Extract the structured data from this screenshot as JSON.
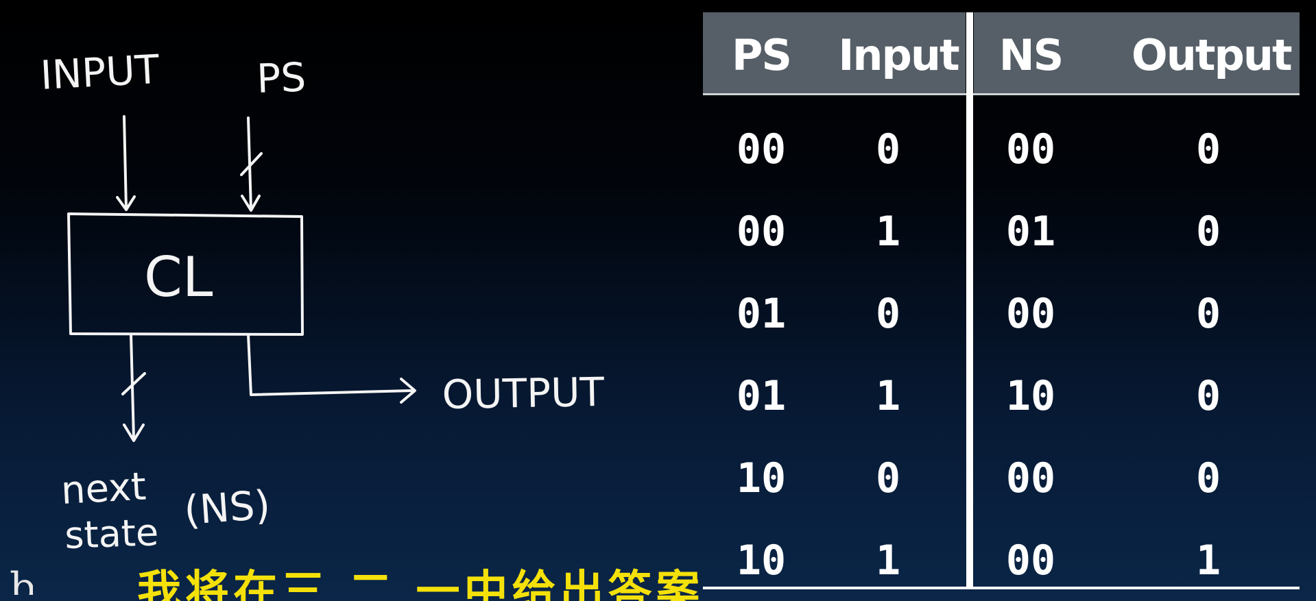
{
  "diagram": {
    "input_label": "INPUT",
    "ps_label": "PS",
    "block_label": "CL",
    "output_label": "OUTPUT",
    "next_label": "next",
    "state_label": "state",
    "ns_label": "(NS)"
  },
  "table": {
    "headers": {
      "ps": "PS",
      "input": "Input",
      "ns": "NS",
      "output": "Output"
    },
    "rows": [
      {
        "ps": "00",
        "input": "0",
        "ns": "00",
        "output": "0"
      },
      {
        "ps": "00",
        "input": "1",
        "ns": "01",
        "output": "0"
      },
      {
        "ps": "01",
        "input": "0",
        "ns": "00",
        "output": "0"
      },
      {
        "ps": "01",
        "input": "1",
        "ns": "10",
        "output": "0"
      },
      {
        "ps": "10",
        "input": "0",
        "ns": "00",
        "output": "0"
      },
      {
        "ps": "10",
        "input": "1",
        "ns": "00",
        "output": "1"
      }
    ]
  },
  "subtitle": {
    "text": "我将在三 二 一中给出答案"
  },
  "colors": {
    "header_bg": "#565f67",
    "subtitle": "#f5e10a",
    "text": "#ffffff"
  }
}
